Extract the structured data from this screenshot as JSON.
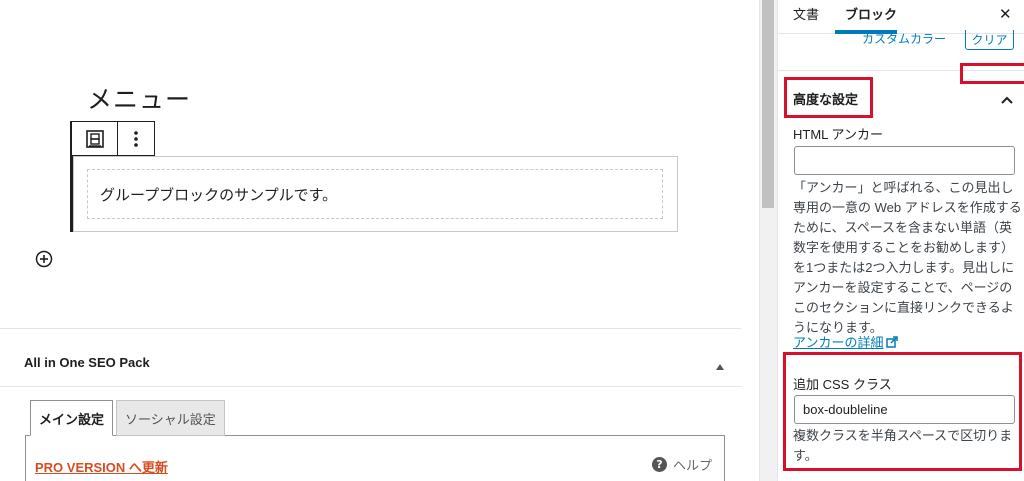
{
  "editor": {
    "heading": "メニュー",
    "paragraph": "グループブロックのサンプルです。"
  },
  "metabox": {
    "title": "All in One SEO Pack",
    "tabs": [
      "メイン設定",
      "ソーシャル設定"
    ],
    "pro_link": "PRO VERSION へ更新",
    "help_label": "ヘルプ",
    "help_icon_glyph": "?"
  },
  "sidebar": {
    "tabs": {
      "document": "文書",
      "block": "ブロック"
    },
    "close": "✕",
    "cut_link": "カスタムカラー",
    "cut_button": "クリア",
    "advanced": {
      "title": "高度な設定",
      "html_anchor_label": "HTML アンカー",
      "html_anchor_value": "",
      "anchor_help_lines": [
        "「アンカー」と呼ばれる、この見出し",
        "専用の一意の Web アドレスを作成する",
        "ために、スペースを含まない単語（英",
        "数字を使用することをお勧めします）",
        "を1つまたは2つ入力します。見出しに",
        "アンカーを設定することで、ページの",
        "このセクションに直接リンクできるよ",
        "うになります。"
      ],
      "anchor_link": "アンカーの詳細",
      "css_label": "追加 CSS クラス",
      "css_value": "box-doubleline",
      "css_help_lines": [
        "複数クラスを半角スペースで区切りま",
        "す。"
      ]
    }
  },
  "colors": {
    "accent": "#007cba",
    "highlight": "#d8102b",
    "pro": "#d54e21"
  }
}
